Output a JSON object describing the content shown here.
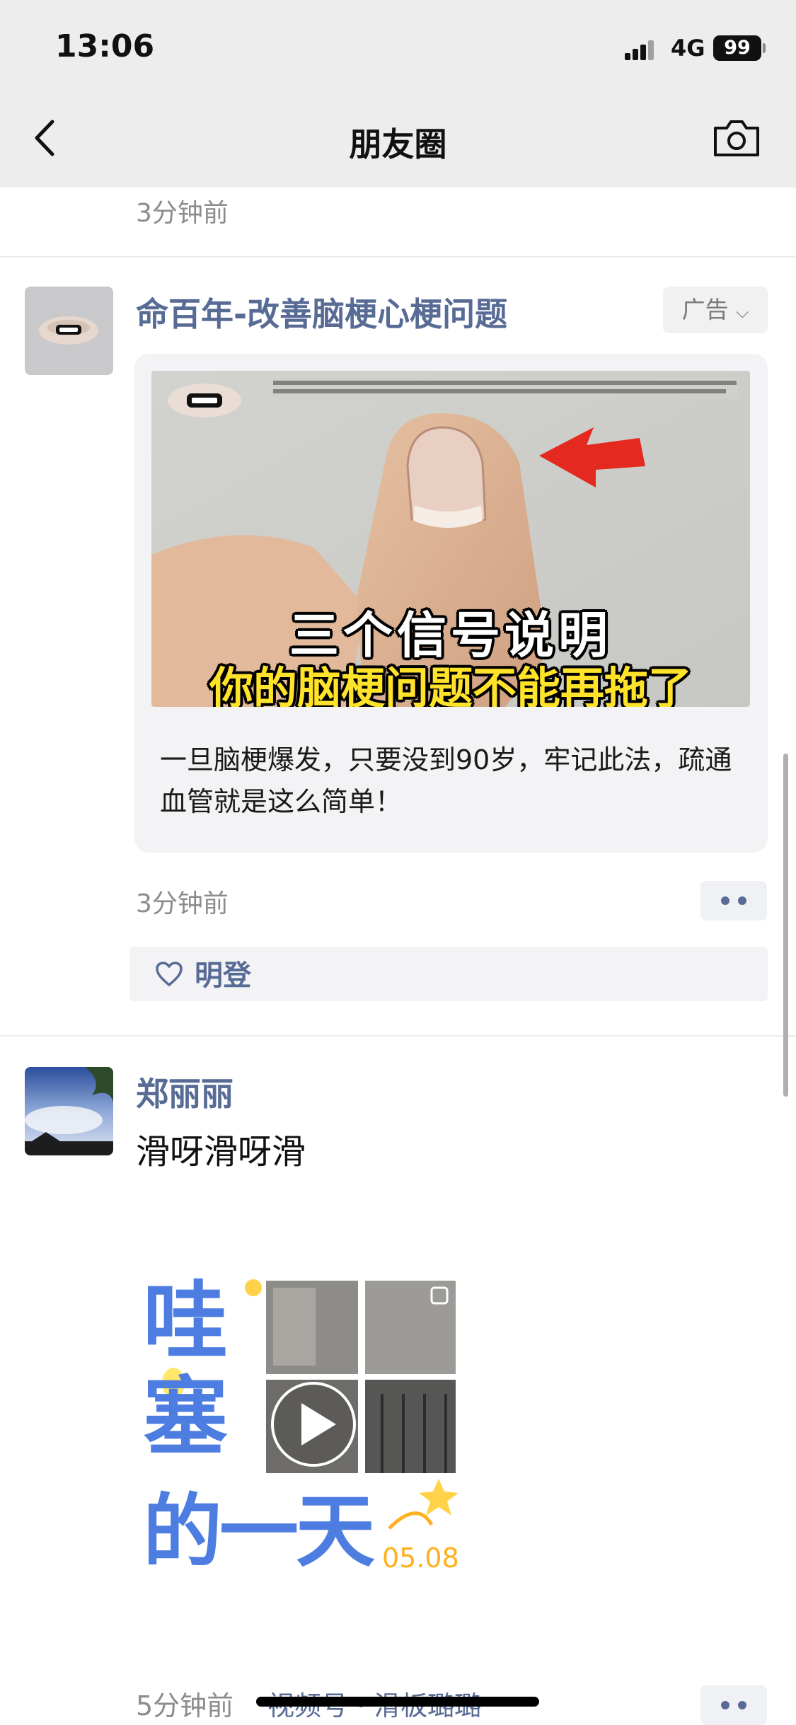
{
  "status_bar": {
    "time": "13:06",
    "network": "4G",
    "battery": "99"
  },
  "nav": {
    "title": "朋友圈"
  },
  "feed": {
    "top_timestamp": "3分钟前",
    "ad_post": {
      "author": "命百年-改善脑梗心梗问题",
      "ad_label": "广告",
      "image_line1": "三个信号说明",
      "image_line2": "你的脑梗问题不能再拖了",
      "text": "一旦脑梗爆发，只要没到90岁，牢记此法，疏通血管就是这么简单！",
      "timestamp": "3分钟前",
      "likes": "明登"
    },
    "user_post": {
      "author": "郑丽丽",
      "text": "滑呀滑呀滑",
      "media_caption_line1": "哇塞",
      "media_caption_line2": "的一天",
      "media_date": "05.08",
      "timestamp": "5分钟前",
      "channel_link": "视频号 · 滑板璐璐"
    }
  }
}
